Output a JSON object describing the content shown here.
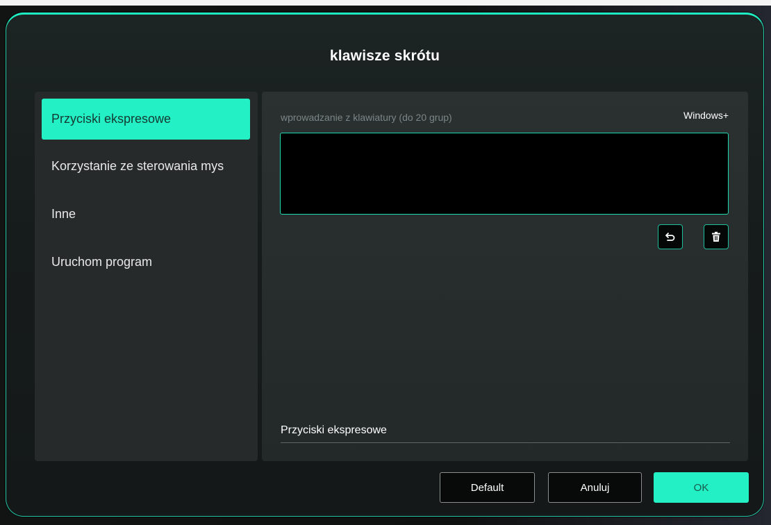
{
  "dialog": {
    "title": "klawisze skrótu"
  },
  "sidebar": {
    "items": [
      {
        "label": "Przyciski ekspresowe",
        "active": true
      },
      {
        "label": "Korzystanie ze sterowania mys",
        "active": false
      },
      {
        "label": "Inne",
        "active": false
      },
      {
        "label": "Uruchom program",
        "active": false
      }
    ]
  },
  "main": {
    "input_label": "wprowadzanie z klawiatury (do 20 grup)",
    "os_label": "Windows+",
    "key_input_value": "",
    "name_field_value": "Przyciski ekspresowe",
    "icons": {
      "undo": "undo-icon",
      "delete": "trash-icon"
    }
  },
  "footer": {
    "default_label": "Default",
    "cancel_label": "Anuluj",
    "ok_label": "OK"
  },
  "colors": {
    "accent": "#23f0c4",
    "border_accent": "#1fd9b0",
    "panel": "#262a2a"
  }
}
